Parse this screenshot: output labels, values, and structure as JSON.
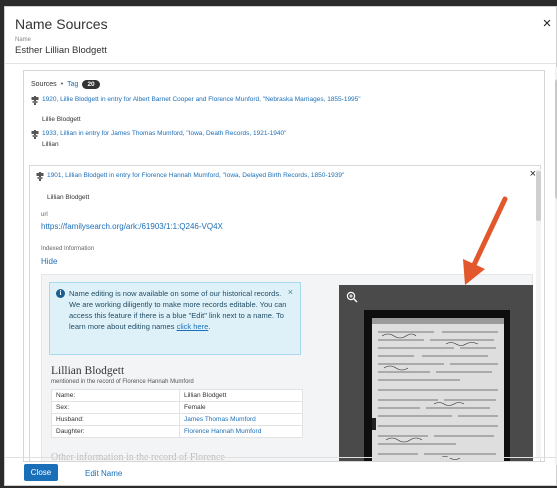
{
  "modal": {
    "title": "Name Sources",
    "close_symbol": "×",
    "name_label": "Name",
    "name_value": "Esther Lillian Blodgett"
  },
  "sources": {
    "label": "Sources",
    "separator": "•",
    "tag_label": "Tag",
    "tag_count": "20",
    "entries": [
      {
        "title": "1920, Lillie Blodgett in entry for Albert Barnet Cooper and Florence Munford, \"Nebraska Marriages, 1855-1995\"",
        "name": "Lillie Blodgett",
        "icon": "source-pin-icon"
      },
      {
        "title": "1933, Lillian in entry for James Thomas Mumford, \"Iowa, Death Records, 1921-1940\"",
        "name": "Lillian",
        "icon": "source-pin-icon"
      }
    ],
    "expanded": {
      "title": "1901, Lillian Blodgett in entry for Florence Hannah Mumford, \"Iowa, Delayed Birth Records, 1850-1939\"",
      "name": "Lillian Blodgett",
      "close_symbol": "×",
      "url_label": "url",
      "url_value": "https://familysearch.org/ark:/61903/1:1:Q246-VQ4X",
      "indexed_label": "Indexed Information",
      "hide_label": "Hide"
    }
  },
  "info_banner": {
    "text": "Name editing is now available on some of our historical records. We are working diligently to make more records editable. You can access this feature if there is a blue \"Edit\" link next to a name. To learn more about editing names ",
    "link_text": "click here",
    "link_suffix": ".",
    "close_symbol": "×",
    "icon": "info-icon"
  },
  "person": {
    "name": "Lillian Blodgett",
    "subtitle": "mentioned in the record of Florence Hannah Mumford",
    "details": [
      {
        "key": "Name:",
        "value": "Lillian Blodgett",
        "link": false
      },
      {
        "key": "Sex:",
        "value": "Female",
        "link": false
      },
      {
        "key": "Husband:",
        "value": "James Thomas Mumford",
        "link": true
      },
      {
        "key": "Daughter:",
        "value": "Florence Hannah Mumford",
        "link": true
      }
    ],
    "more_heading": "Other information in the record of Florence"
  },
  "footer": {
    "close_label": "Close",
    "edit_name_label": "Edit Name"
  },
  "colors": {
    "accent": "#1b6fb8",
    "info_bg": "#dff1f8",
    "annotation_arrow": "#e2572b"
  }
}
